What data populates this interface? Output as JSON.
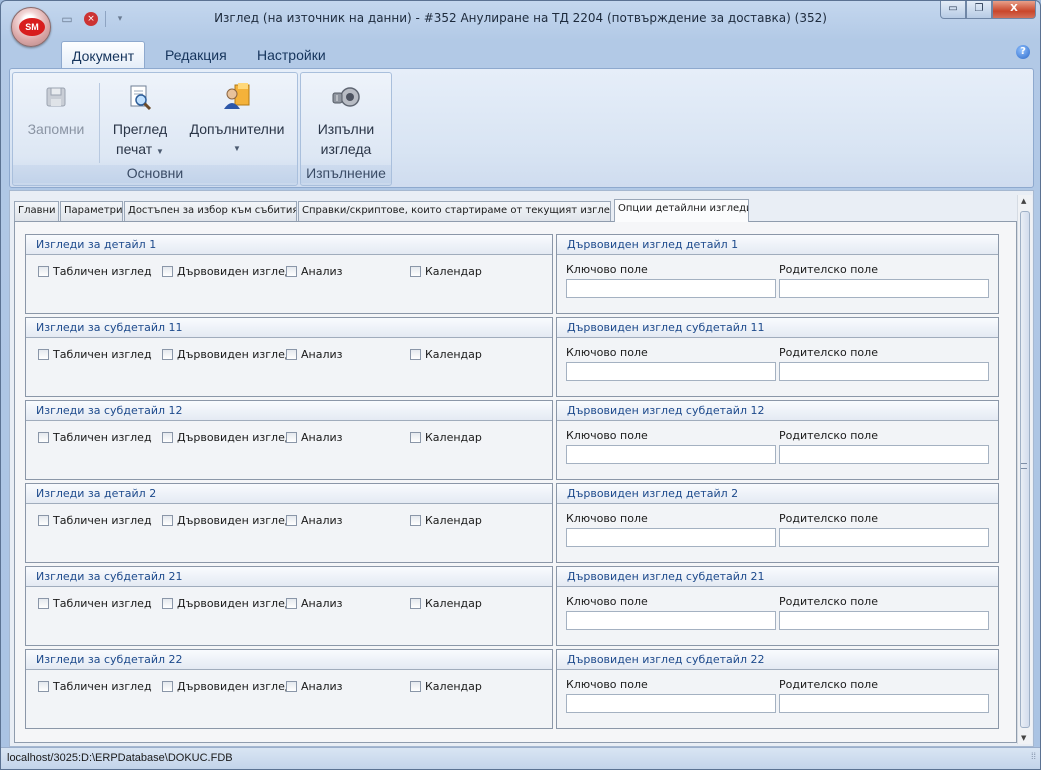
{
  "window": {
    "title": "Изглед (на източник на данни) - #352 Анулиране на ТД 2204 (потвърждение за доставка) (352)",
    "app_logo": "SM",
    "controls": {
      "minimize": "▭",
      "maximize": "❐",
      "close": "X"
    }
  },
  "ribbon": {
    "tabs": [
      {
        "label": "Документ"
      },
      {
        "label": "Редакция"
      },
      {
        "label": "Настройки"
      }
    ],
    "groups": {
      "basic": {
        "label": "Основни"
      },
      "execution": {
        "label": "Изпълнение"
      }
    },
    "buttons": {
      "save": {
        "label": "Запомни"
      },
      "preview_line1": "Преглед",
      "preview_line2": "печат",
      "additional": {
        "label": "Допълнителни"
      },
      "execute_line1": "Изпълни",
      "execute_line2": "изгледа"
    },
    "help": "?"
  },
  "tabs": [
    {
      "label": "Главни"
    },
    {
      "label": "Параметри"
    },
    {
      "label": "Достъпен за избор към събития"
    },
    {
      "label": "Справки/скриптове, които стартираме от текущият изглед"
    },
    {
      "label": "Опции детайлни изгледи"
    }
  ],
  "checkbox_labels": {
    "table": "Табличен изглед",
    "tree": "Дървовиден изглед",
    "analysis": "Анализ",
    "calendar": "Календар"
  },
  "field_labels": {
    "key": "Ключово поле",
    "parent": "Родителско поле"
  },
  "rows": [
    {
      "views_title": "Изгледи за детайл 1",
      "tree_title": "Дървовиден изглед детайл 1"
    },
    {
      "views_title": "Изгледи за субдетайл 11",
      "tree_title": "Дървовиден изглед субдетайл 11"
    },
    {
      "views_title": "Изгледи за субдетайл 12",
      "tree_title": "Дървовиден изглед субдетайл 12"
    },
    {
      "views_title": "Изгледи за детайл 2",
      "tree_title": "Дървовиден изглед детайл 2"
    },
    {
      "views_title": "Изгледи за субдетайл 21",
      "tree_title": "Дървовиден изглед субдетайл 21"
    },
    {
      "views_title": "Изгледи за субдетайл 22",
      "tree_title": "Дървовиден изглед субдетайл 22"
    }
  ],
  "statusbar": {
    "text": "localhost/3025:D:\\ERPDatabase\\DOKUC.FDB"
  }
}
